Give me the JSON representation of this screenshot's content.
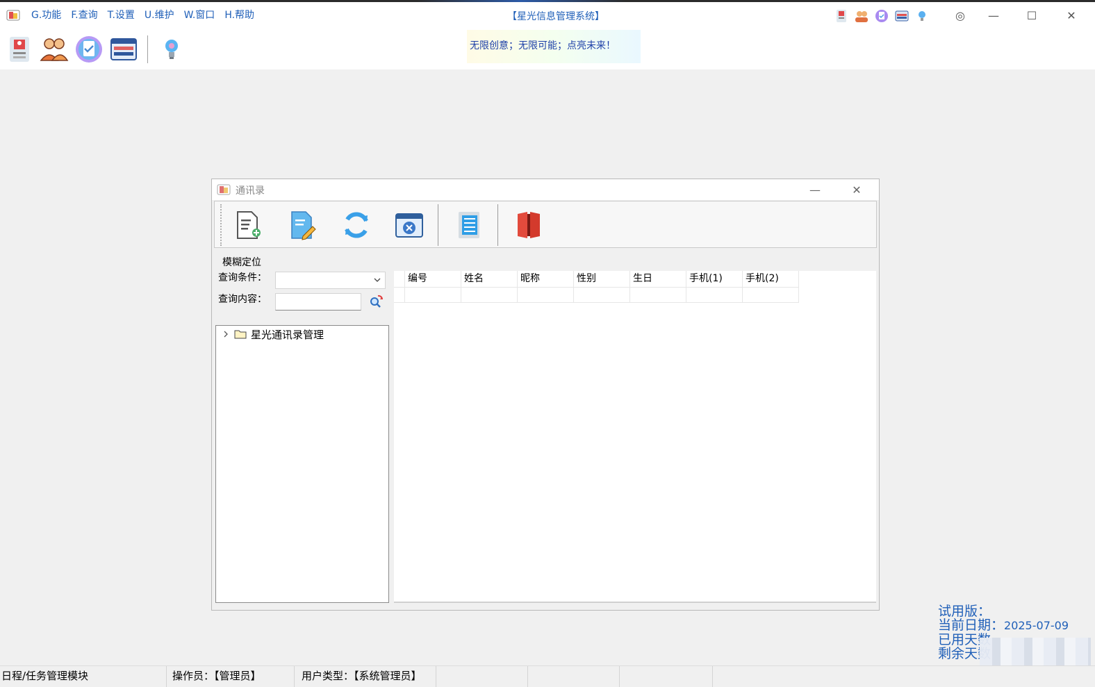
{
  "app": {
    "title": "【星光信息管理系统】",
    "slogan": "无限创意；无限可能；点亮未来！"
  },
  "menu": [
    "G.功能",
    "F.查询",
    "T.设置",
    "U.维护",
    "W.窗口",
    "H.帮助"
  ],
  "toolbar": {
    "icons": [
      "id-card-icon",
      "users-icon",
      "clipboard-check-icon",
      "screen-panel-icon",
      "lightbulb-icon"
    ]
  },
  "window_controls": {
    "minimize": "—",
    "maximize": "☐",
    "close": "✕",
    "settings": "◎"
  },
  "child_window": {
    "title": "通讯录",
    "minimize": "—",
    "close": "✕",
    "toolbar_icons": [
      "add-record-icon",
      "edit-record-icon",
      "refresh-icon",
      "delete-record-icon",
      "list-view-icon",
      "exit-door-icon"
    ],
    "group_title": "模糊定位",
    "query_condition_label": "查询条件：",
    "query_condition_value": "",
    "query_content_label": "查询内容：",
    "query_content_value": "",
    "tree": {
      "root_label": "星光通讯录管理",
      "expanded": false
    },
    "grid": {
      "columns": [
        "编号",
        "姓名",
        "昵称",
        "性别",
        "生日",
        "手机(1)",
        "手机(2)"
      ],
      "rows": [
        [
          "",
          "",
          "",
          "",
          "",
          "",
          ""
        ]
      ]
    }
  },
  "trial": {
    "line1": "试用版：",
    "line2_label": "当前日期：",
    "line2_value": "2025-07-09",
    "line3_label": "已用天数",
    "line4_label": "剩余天数"
  },
  "status": {
    "module": "日程/任务管理模块",
    "operator": "操作员：【管理员】",
    "user_type": "用户类型：【系统管理员】"
  },
  "colors": {
    "accent": "#1f5fb8",
    "background": "#f0f0f0"
  }
}
